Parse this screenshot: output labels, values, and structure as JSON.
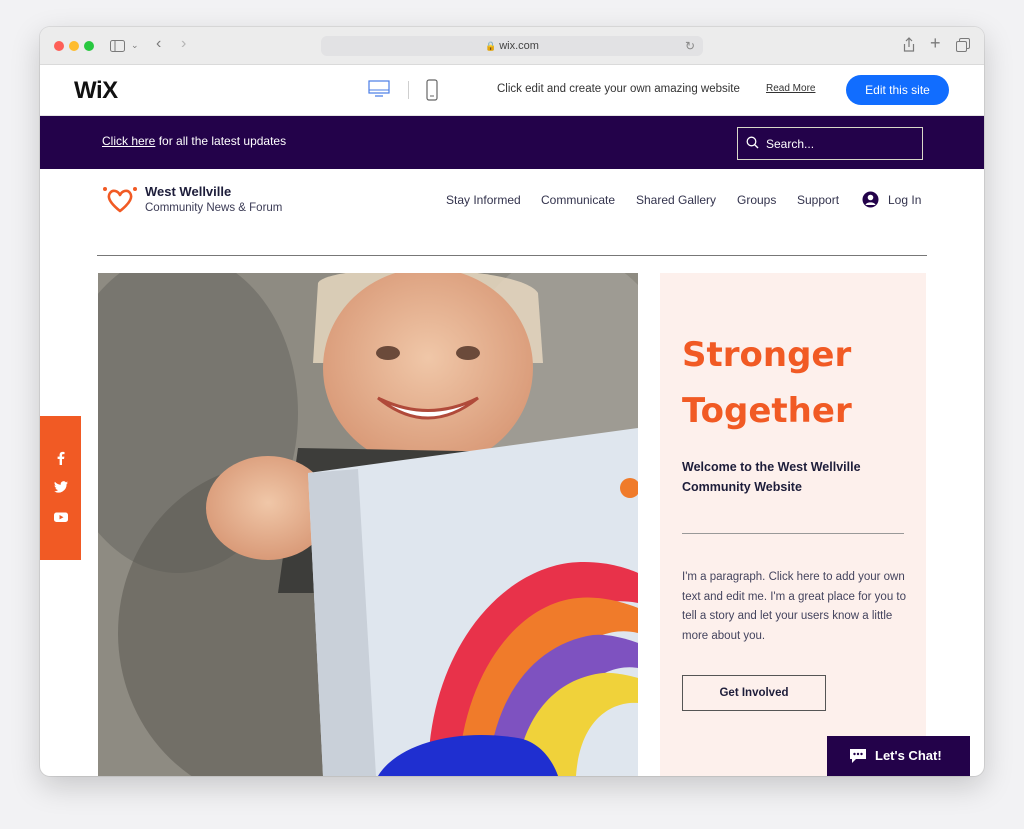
{
  "browser": {
    "url": "wix.com"
  },
  "wix_bar": {
    "logo": "WiX",
    "promo_text": "Click edit and create your own amazing website",
    "read_more": "Read More",
    "edit_button": "Edit this site"
  },
  "announcement": {
    "link_text": "Click here",
    "text": " for all the latest updates",
    "search_placeholder": "Search..."
  },
  "site": {
    "name": "West Wellville",
    "subtitle": "Community News & Forum",
    "nav": [
      "Stay Informed",
      "Communicate",
      "Shared Gallery",
      "Groups",
      "Support"
    ],
    "login": "Log In"
  },
  "hero_panel": {
    "headline": "Stronger Together",
    "welcome": "Welcome to the West Wellville Community Website",
    "paragraph": "I'm a paragraph. Click here to add your own text and edit me. I'm a great place for you to tell a story and let your users know a little more about you.",
    "button": "Get Involved"
  },
  "social": [
    "facebook-icon",
    "twitter-icon",
    "youtube-icon"
  ],
  "chat": {
    "label": "Let's Chat!"
  },
  "colors": {
    "brand_orange": "#f15a24",
    "deep_purple": "#23024a",
    "wix_blue": "#116dff",
    "panel_bg": "#fdf0ec"
  }
}
